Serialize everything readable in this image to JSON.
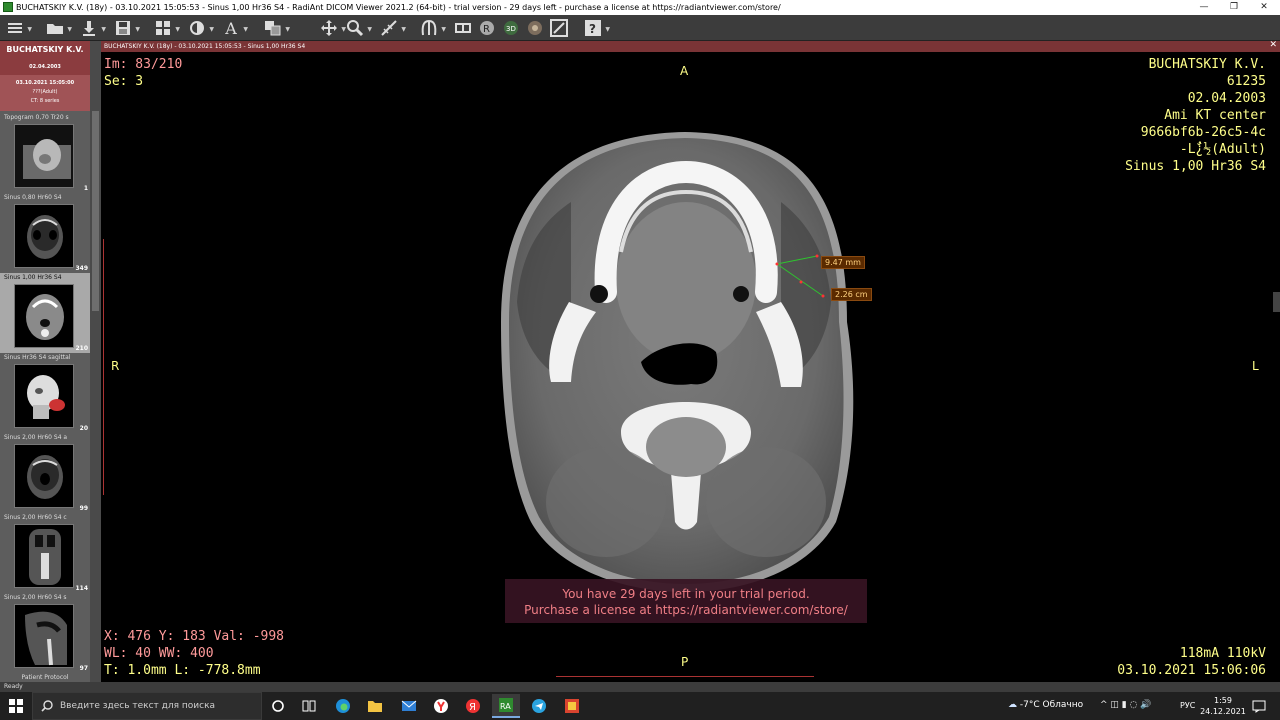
{
  "window": {
    "title": "BUCHATSKIY K.V. (18y) - 03.10.2021 15:05:53 - Sinus  1,00  Hr36  S4 - RadiAnt DICOM Viewer 2021.2 (64-bit) - trial version - 29 days left - purchase a license at https://radiantviewer.com/store/",
    "minimize": "—",
    "maximize": "❐",
    "close": "✕"
  },
  "toolbar": {
    "icons": [
      "menu-icon",
      "open-folder-icon",
      "download-icon",
      "save-icon",
      "layout-icon",
      "window-level-icon",
      "text-annotation-icon",
      "series-sync-icon",
      "pan-icon",
      "zoom-icon",
      "measure-icon",
      "mpr-icon",
      "cine-icon",
      "reference-icon",
      "3d-icon",
      "fusion-icon",
      "fullscreen-icon",
      "help-icon"
    ],
    "text_tool_label": "A"
  },
  "sidebar": {
    "patient_name": "BUCHATSKIY K.V.",
    "patient_dob": "02.04.2003",
    "study_datetime": "03.10.2021 15:05:00",
    "study_age": "???(Adult)",
    "study_series": "CT: 8 series",
    "series": [
      {
        "label": "Topogram  0,70  Tr20  s",
        "count": "1",
        "kind": "topogram"
      },
      {
        "label": "Sinus  0,80  Hr60  S4",
        "count": "349",
        "kind": "axial"
      },
      {
        "label": "Sinus  1,00  Hr36  S4",
        "count": "210",
        "kind": "axial-soft"
      },
      {
        "label": "Sinus  Hr36  S4  sagittal",
        "count": "20",
        "kind": "vr"
      },
      {
        "label": "Sinus  2,00  Hr60  S4  a",
        "count": "99",
        "kind": "axial"
      },
      {
        "label": "Sinus  2,00  Hr60  S4  c",
        "count": "114",
        "kind": "coronal"
      },
      {
        "label": "Sinus  2,00  Hr60  S4  s",
        "count": "97",
        "kind": "sagittal"
      }
    ],
    "protocol_label": "Patient Protocol"
  },
  "viewport": {
    "header": "BUCHATSKIY K.V. (18y) - 03.10.2021 15:05:53 - Sinus  1,00  Hr36  S4",
    "close": "✕",
    "top_left": {
      "image": "Im: 83/210",
      "series": "Se: 3"
    },
    "top_right": {
      "name": "BUCHATSKIY K.V.",
      "id": "61235",
      "dob": "02.04.2003",
      "institution": "Ami KT center",
      "uid": "9666bf6b-26c5-4c",
      "sex_age": "-Lٌٌ¿½(Adult)",
      "series_desc": "Sinus  1,00  Hr36  S4"
    },
    "orientation": {
      "top": "A",
      "bottom": "P",
      "left": "R",
      "right": "L"
    },
    "bottom_left": {
      "cursor": "X: 476 Y: 183 Val: -998",
      "window": "WL: 40 WW: 400",
      "thickness": "T: 1.0mm L: -778.8mm"
    },
    "bottom_right": {
      "exposure": "118mA 110kV",
      "datetime": "03.10.2021 15:06:06"
    },
    "measurements": [
      {
        "label": "9.47 mm"
      },
      {
        "label": "2.26 cm"
      }
    ],
    "trial_message_1": "You have 29 days left in your trial period.",
    "trial_message_2": "Purchase a license at https://radiantviewer.com/store/"
  },
  "status": {
    "text": "Ready"
  },
  "taskbar": {
    "search_placeholder": "Введите здесь текст для поиска",
    "apps": [
      "cortana-icon",
      "task-view-icon",
      "edge-icon",
      "file-explorer-icon",
      "mail-icon",
      "yandex-browser-icon",
      "yandex-icon",
      "radiant-icon",
      "telegram-icon",
      "photo-icon"
    ],
    "weather": "-7°C  Облачно",
    "tray": "^  ◫  ▮  ◌  🔊",
    "language": "РУС",
    "time": "1:59",
    "date": "24.12.2021",
    "colors": {
      "taskbar": "#202020",
      "accent": "#7aa9e0"
    }
  }
}
